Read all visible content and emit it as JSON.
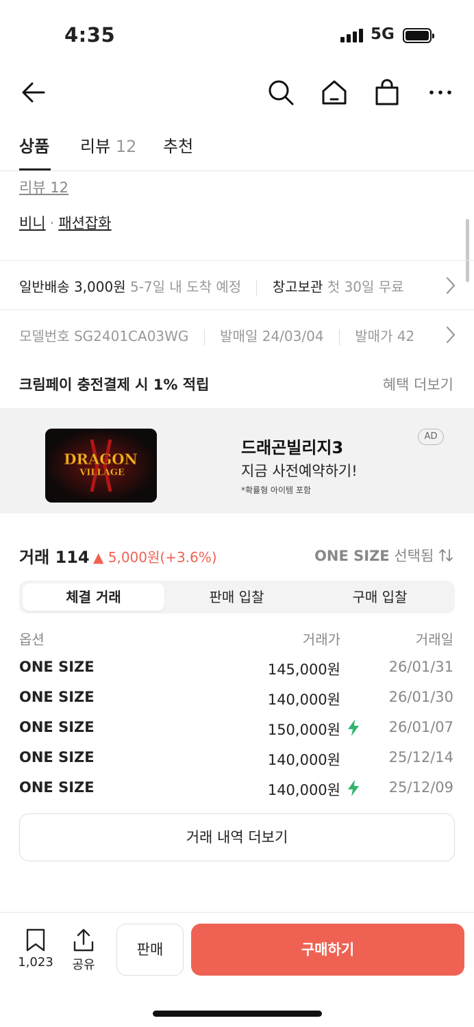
{
  "status_bar": {
    "time": "4:35",
    "network": "5G"
  },
  "tabs": [
    {
      "label": "상품",
      "count": ""
    },
    {
      "label": "리뷰",
      "count": "12"
    },
    {
      "label": "추천",
      "count": ""
    }
  ],
  "product": {
    "review_link": "리뷰 12",
    "brand": "비니",
    "separator": "·",
    "category": "패션잡화"
  },
  "delivery": {
    "shipping_label": "일반배송 3,000원",
    "shipping_eta": "5-7일 내 도착 예정",
    "storage_label": "창고보관",
    "storage_note": "첫 30일 무료"
  },
  "specs": {
    "model_label": "모델번호",
    "model_value": "SG2401CA03WG",
    "release_label": "발매일",
    "release_value": "24/03/04",
    "price_label": "발매가",
    "price_value": "42"
  },
  "benefit": {
    "label": "크림페이 충전결제 시 1% 적립",
    "more": "혜택 더보기"
  },
  "ad": {
    "logo_text_line1": "DRAGON",
    "logo_text_line2": "VILLAGE",
    "title": "드래곤빌리지3",
    "subtitle": "지금 사전예약하기!",
    "note": "*확률형 아이템 포함",
    "badge": "AD"
  },
  "trades": {
    "title": "거래",
    "count": "114",
    "change": "▲ 5,000원(+3.6%)",
    "size_value": "ONE SIZE",
    "size_suffix": "선택됨",
    "segments": [
      "체결 거래",
      "판매 입찰",
      "구매 입찰"
    ],
    "columns": {
      "option": "옵션",
      "price": "거래가",
      "date": "거래일"
    },
    "rows": [
      {
        "option": "ONE SIZE",
        "price": "145,000원",
        "date": "26/01/31",
        "fast": false
      },
      {
        "option": "ONE SIZE",
        "price": "140,000원",
        "date": "26/01/30",
        "fast": false
      },
      {
        "option": "ONE SIZE",
        "price": "150,000원",
        "date": "26/01/07",
        "fast": true
      },
      {
        "option": "ONE SIZE",
        "price": "140,000원",
        "date": "25/12/14",
        "fast": false
      },
      {
        "option": "ONE SIZE",
        "price": "140,000원",
        "date": "25/12/09",
        "fast": true
      }
    ],
    "more_button": "거래 내역 더보기"
  },
  "bottom_bar": {
    "bookmark_count": "1,023",
    "share_label": "공유",
    "sell_label": "판매",
    "buy_label": "구매하기"
  },
  "colors": {
    "accent": "#ef6253",
    "fast_bolt": "#31b46e"
  }
}
